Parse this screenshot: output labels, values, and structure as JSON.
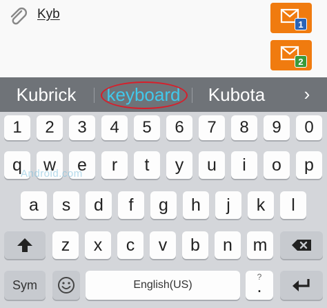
{
  "compose": {
    "text": "Kyb",
    "attach_icon": "paperclip-icon",
    "mail_buttons": [
      {
        "icon": "mail-icon",
        "badge": "1",
        "color": "#f07b0f",
        "badge_color": "#2a64b8"
      },
      {
        "icon": "mail-icon",
        "badge": "2",
        "color": "#f07b0f",
        "badge_color": "#3a9a3a"
      }
    ]
  },
  "suggestions": {
    "items": [
      "Kubrick",
      "keyboard",
      "Kubota"
    ],
    "selected_index": 1,
    "selected_color": "#41c9ec",
    "more_icon": "chevron-right-icon",
    "more_glyph": "›"
  },
  "keyboard": {
    "number_row": [
      "1",
      "2",
      "3",
      "4",
      "5",
      "6",
      "7",
      "8",
      "9",
      "0"
    ],
    "row1": [
      "q",
      "w",
      "e",
      "r",
      "t",
      "y",
      "u",
      "i",
      "o",
      "p"
    ],
    "row2": [
      "a",
      "s",
      "d",
      "f",
      "g",
      "h",
      "j",
      "k",
      "l"
    ],
    "row3": [
      "z",
      "x",
      "c",
      "v",
      "b",
      "n",
      "m"
    ],
    "shift_icon": "shift-arrow-icon",
    "backspace_icon": "backspace-icon",
    "sym_label": "Sym",
    "emoji_icon": "smiley-icon",
    "space_label": "English(US)",
    "period_label": ".",
    "punct_hint": "?",
    "enter_icon": "enter-icon"
  },
  "watermark": "Android.com"
}
